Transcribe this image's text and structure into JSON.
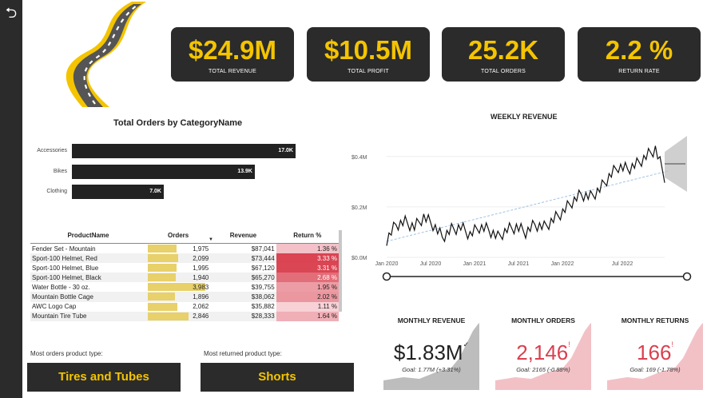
{
  "nav": {
    "back_icon": "back-arrow-icon"
  },
  "kpis": [
    {
      "value": "$24.9M",
      "label": "TOTAL REVENUE"
    },
    {
      "value": "$10.5M",
      "label": "TOTAL PROFIT"
    },
    {
      "value": "25.2K",
      "label": "TOTAL ORDERS"
    },
    {
      "value": "2.2 %",
      "label": "RETURN RATE"
    }
  ],
  "colors": {
    "accent": "#f4c400",
    "card": "#2b2b2b",
    "return_high": "#d9404f",
    "return_low": "#f8d8dc"
  },
  "category_chart": {
    "title": "Total Orders by CategoryName",
    "items": [
      {
        "label": "Accessories",
        "value": "17.0K",
        "amount": 17.0
      },
      {
        "label": "Bikes",
        "value": "13.9K",
        "amount": 13.9
      },
      {
        "label": "Clothing",
        "value": "7.0K",
        "amount": 7.0
      }
    ]
  },
  "table": {
    "headers": [
      "ProductName",
      "Orders",
      "Revenue",
      "Return %"
    ],
    "rows": [
      {
        "name": "Fender Set - Mountain",
        "orders": "1,975",
        "orders_n": 1975,
        "revenue": "$87,041",
        "ret": "1.36 %",
        "ret_n": 1.36
      },
      {
        "name": "Sport-100 Helmet, Red",
        "orders": "2,099",
        "orders_n": 2099,
        "revenue": "$73,444",
        "ret": "3.33 %",
        "ret_n": 3.33
      },
      {
        "name": "Sport-100 Helmet, Blue",
        "orders": "1,995",
        "orders_n": 1995,
        "revenue": "$67,120",
        "ret": "3.31 %",
        "ret_n": 3.31
      },
      {
        "name": "Sport-100 Helmet, Black",
        "orders": "1,940",
        "orders_n": 1940,
        "revenue": "$65,270",
        "ret": "2.68 %",
        "ret_n": 2.68
      },
      {
        "name": "Water Bottle - 30 oz.",
        "orders": "3,983",
        "orders_n": 3983,
        "revenue": "$39,755",
        "ret": "1.95 %",
        "ret_n": 1.95
      },
      {
        "name": "Mountain Bottle Cage",
        "orders": "1,896",
        "orders_n": 1896,
        "revenue": "$38,062",
        "ret": "2.02 %",
        "ret_n": 2.02
      },
      {
        "name": "AWC Logo Cap",
        "orders": "2,062",
        "orders_n": 2062,
        "revenue": "$35,882",
        "ret": "1.11 %",
        "ret_n": 1.11
      },
      {
        "name": "Mountain Tire Tube",
        "orders": "2,846",
        "orders_n": 2846,
        "revenue": "$28,333",
        "ret": "1.64 %",
        "ret_n": 1.64
      }
    ]
  },
  "bottom": {
    "most_orders_label": "Most orders product type:",
    "most_orders_value": "Tires and Tubes",
    "most_returned_label": "Most returned product type:",
    "most_returned_value": "Shorts"
  },
  "weekly": {
    "title": "WEEKLY REVENUE",
    "y_ticks": [
      "$0.4M",
      "$0.2M",
      "$0.0M"
    ],
    "x_ticks": [
      "Jan 2020",
      "Jul 2020",
      "Jan 2021",
      "Jul 2021",
      "Jan 2022",
      "Jul 2022"
    ]
  },
  "chart_data": {
    "type": "line",
    "title": "WEEKLY REVENUE",
    "ylim": [
      0,
      0.45
    ],
    "x": [
      "2020-01",
      "2020-02",
      "2020-03",
      "2020-04",
      "2020-05",
      "2020-06",
      "2020-07",
      "2020-08",
      "2020-09",
      "2020-10",
      "2020-11",
      "2020-12",
      "2021-01",
      "2021-02",
      "2021-03",
      "2021-04",
      "2021-05",
      "2021-06",
      "2021-07",
      "2021-08",
      "2021-09",
      "2021-10",
      "2021-11",
      "2021-12",
      "2022-01",
      "2022-02",
      "2022-03",
      "2022-04",
      "2022-05",
      "2022-06",
      "2022-07"
    ],
    "series": [
      {
        "values": [
          0.07,
          0.13,
          0.14,
          0.12,
          0.16,
          0.13,
          0.08,
          0.11,
          0.12,
          0.09,
          0.12,
          0.11,
          0.08,
          0.11,
          0.12,
          0.1,
          0.13,
          0.12,
          0.15,
          0.18,
          0.22,
          0.25,
          0.24,
          0.27,
          0.32,
          0.36,
          0.35,
          0.37,
          0.4,
          0.43,
          0.32
        ]
      }
    ]
  },
  "mini": [
    {
      "title": "MONTHLY REVENUE",
      "value": "$1.83M",
      "goal": "Goal: 1.77M (+3.31%)",
      "color": "#222222",
      "mark": "✓"
    },
    {
      "title": "MONTHLY ORDERS",
      "value": "2,146",
      "goal": "Goal: 2165 (-0.88%)",
      "color": "#d9404f",
      "mark": "!"
    },
    {
      "title": "MONTHLY RETURNS",
      "value": "166",
      "goal": "Goal: 169 (-1.78%)",
      "color": "#d9404f",
      "mark": "!"
    }
  ]
}
